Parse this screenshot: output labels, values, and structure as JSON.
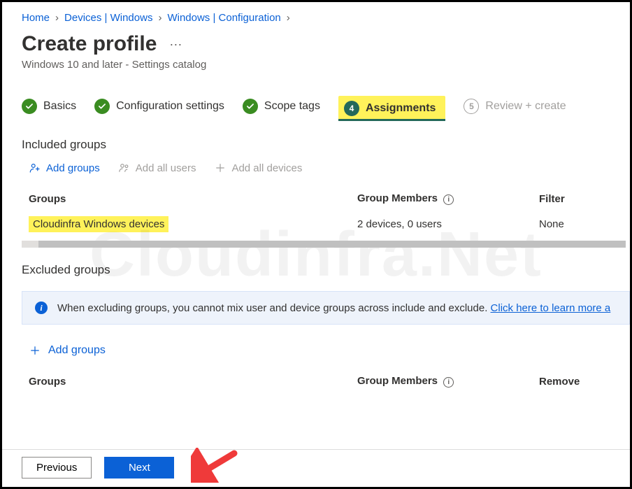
{
  "breadcrumb": {
    "home": "Home",
    "devices": "Devices | Windows",
    "windows": "Windows | Configuration"
  },
  "page": {
    "title": "Create profile",
    "subtitle": "Windows 10 and later - Settings catalog"
  },
  "steps": {
    "basics": "Basics",
    "config": "Configuration settings",
    "scope": "Scope tags",
    "assignments_num": "4",
    "assignments": "Assignments",
    "review_num": "5",
    "review": "Review + create"
  },
  "included": {
    "title": "Included groups",
    "add_groups": "Add groups",
    "add_all_users": "Add all users",
    "add_all_devices": "Add all devices",
    "col_groups": "Groups",
    "col_members": "Group Members",
    "col_filter": "Filter",
    "row": {
      "name": "Cloudinfra Windows devices",
      "members": "2 devices, 0 users",
      "filter": "None"
    }
  },
  "excluded": {
    "title": "Excluded groups",
    "info": "When excluding groups, you cannot mix user and device groups across include and exclude. ",
    "info_link": "Click here to learn more a",
    "add_groups": "Add groups",
    "col_groups": "Groups",
    "col_members": "Group Members",
    "col_remove": "Remove"
  },
  "footer": {
    "previous": "Previous",
    "next": "Next"
  },
  "watermark": "Cloudinfra.Net"
}
